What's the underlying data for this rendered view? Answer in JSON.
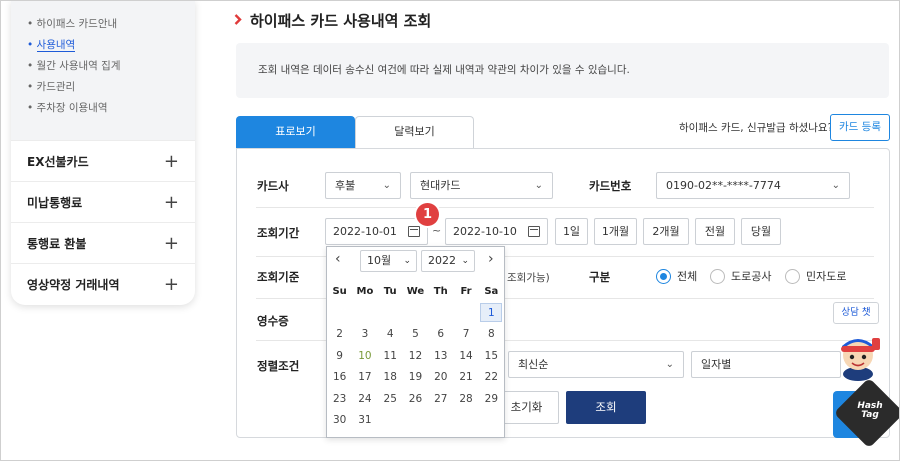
{
  "sidebar": {
    "sub_items": [
      {
        "label": "하이패스 카드안내",
        "active": false
      },
      {
        "label": "사용내역",
        "active": true
      },
      {
        "label": "월간 사용내역 집계",
        "active": false
      },
      {
        "label": "카드관리",
        "active": false
      },
      {
        "label": "주차장 이용내역",
        "active": false
      }
    ],
    "menu": [
      {
        "label": "EX선불카드",
        "icon": "plus-icon"
      },
      {
        "label": "미납통행료",
        "icon": "plus-icon"
      },
      {
        "label": "통행료 환불",
        "icon": "plus-icon"
      },
      {
        "label": "영상약정 거래내역",
        "icon": "plus-icon"
      }
    ],
    "bullet": "•",
    "plus": "+"
  },
  "page": {
    "title": "하이패스 카드 사용내역 조회",
    "notice": "조회 내역은 데이터 송수신 여건에 따라 실제 내역과 약관의 차이가 있을 수 있습니다."
  },
  "tabs": {
    "list_view": "표로보기",
    "calendar_view": "달력보기"
  },
  "apply": {
    "question": "하이패스 카드, 신규발급 하셨나요?",
    "button": "카드 등록"
  },
  "form": {
    "card_company_label": "카드사",
    "card_type": "후불",
    "card_company": "현대카드",
    "card_number_label": "카드번호",
    "card_number": "0190-02**-****-7774",
    "period_label": "조회기간",
    "start_date": "2022-10-01",
    "tilde": "~",
    "end_date": "2022-10-10",
    "period_buttons": [
      "1일",
      "1개월",
      "2개월",
      "전월",
      "당월"
    ],
    "basis_label": "조회기준",
    "basis_hint": "조회가능)",
    "division_label": "구분",
    "division_options": [
      {
        "label": "전체",
        "selected": true
      },
      {
        "label": "도로공사",
        "selected": false
      },
      {
        "label": "민자도로",
        "selected": false
      }
    ],
    "receipt_label": "영수증",
    "sort_label": "정렬조건",
    "sort_order": "최신순",
    "sort_group": "일자별",
    "reset_button": "초기화",
    "search_button": "조회"
  },
  "calendar": {
    "prev": "‹",
    "next": "›",
    "month": "10월",
    "year": "2022",
    "weekdays": [
      "Su",
      "Mo",
      "Tu",
      "We",
      "Th",
      "Fr",
      "Sa"
    ],
    "weeks": [
      [
        "",
        "",
        "",
        "",
        "",
        "",
        "1"
      ],
      [
        "2",
        "3",
        "4",
        "5",
        "6",
        "7",
        "8"
      ],
      [
        "9",
        "10",
        "11",
        "12",
        "13",
        "14",
        "15"
      ],
      [
        "16",
        "17",
        "18",
        "19",
        "20",
        "21",
        "22"
      ],
      [
        "23",
        "24",
        "25",
        "26",
        "27",
        "28",
        "29"
      ],
      [
        "30",
        "31",
        "",
        "",
        "",
        "",
        ""
      ]
    ],
    "selected_day": "1",
    "today_day": "10"
  },
  "floating": {
    "consult": "상담 챗"
  },
  "annotation": {
    "badge": "1"
  },
  "watermark": {
    "line1": "Hash",
    "line2": "Tag"
  },
  "colors": {
    "accent": "#1e86e0",
    "dark_button": "#1e3d7c",
    "badge_red": "#e04040"
  }
}
